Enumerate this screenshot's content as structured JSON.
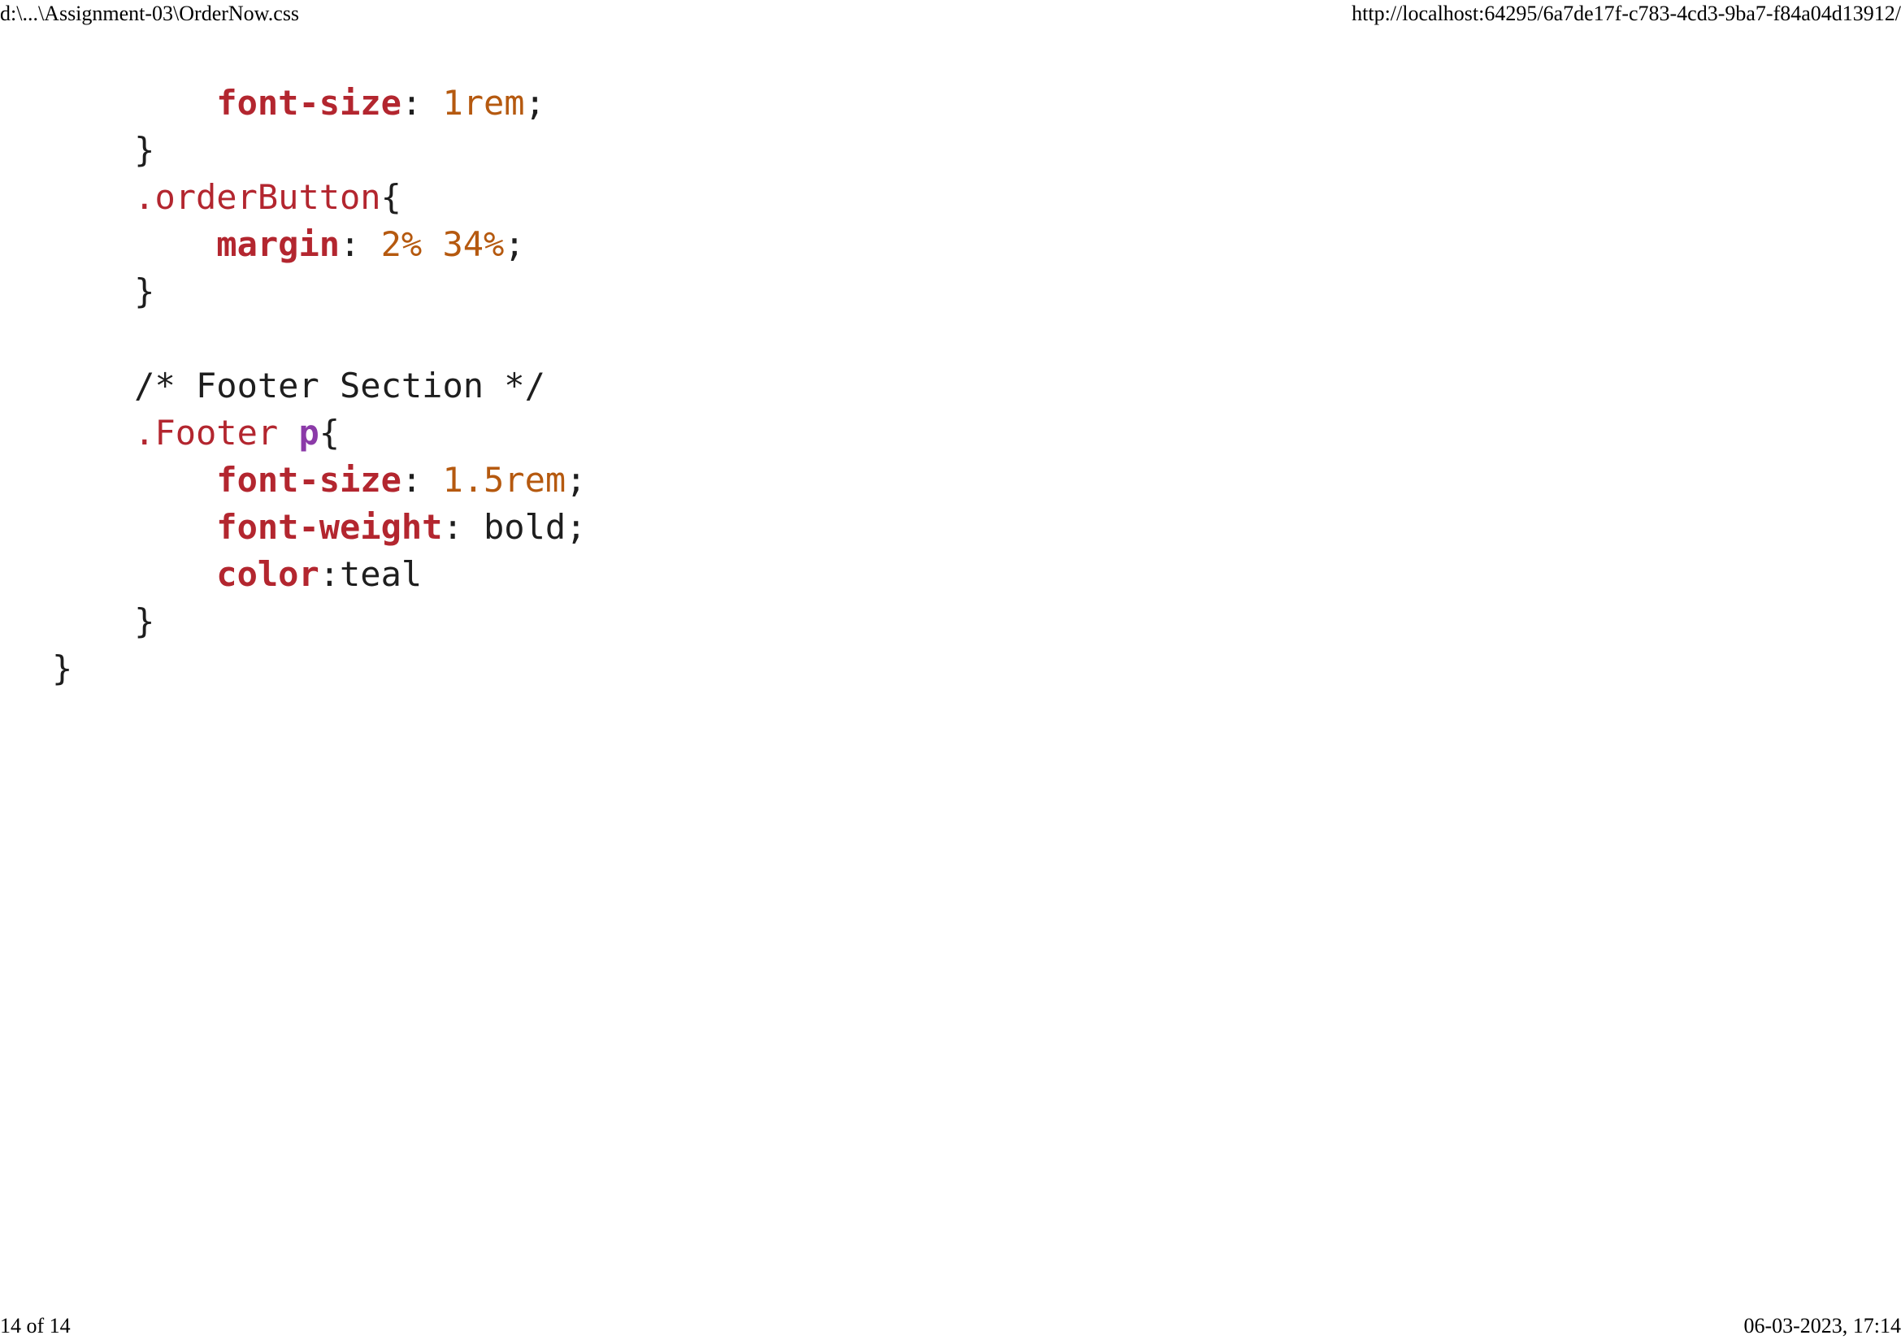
{
  "header": {
    "file_path": "d:\\...\\Assignment-03\\OrderNow.css",
    "url": "http://localhost:64295/6a7de17f-c783-4cd3-9ba7-f84a04d13912/"
  },
  "footer": {
    "page_indicator": "14 of 14",
    "datetime": "06-03-2023, 17:14"
  },
  "code_lines": [
    {
      "indent": "        ",
      "tokens": [
        {
          "t": "prop",
          "v": "font-size"
        },
        {
          "t": "plain",
          "v": ": "
        },
        {
          "t": "num",
          "v": "1rem"
        },
        {
          "t": "plain",
          "v": ";"
        }
      ]
    },
    {
      "indent": "    ",
      "tokens": [
        {
          "t": "plain",
          "v": "}"
        }
      ]
    },
    {
      "indent": "    ",
      "tokens": [
        {
          "t": "sel",
          "v": ".orderButton"
        },
        {
          "t": "plain",
          "v": "{"
        }
      ]
    },
    {
      "indent": "        ",
      "tokens": [
        {
          "t": "prop",
          "v": "margin"
        },
        {
          "t": "plain",
          "v": ": "
        },
        {
          "t": "num",
          "v": "2% 34%"
        },
        {
          "t": "plain",
          "v": ";"
        }
      ]
    },
    {
      "indent": "    ",
      "tokens": [
        {
          "t": "plain",
          "v": "}"
        }
      ]
    },
    {
      "indent": "",
      "tokens": []
    },
    {
      "indent": "    ",
      "tokens": [
        {
          "t": "comment",
          "v": "/* Footer Section */"
        }
      ]
    },
    {
      "indent": "    ",
      "tokens": [
        {
          "t": "sel",
          "v": ".Footer "
        },
        {
          "t": "tag",
          "v": "p"
        },
        {
          "t": "plain",
          "v": "{"
        }
      ]
    },
    {
      "indent": "        ",
      "tokens": [
        {
          "t": "prop",
          "v": "font-size"
        },
        {
          "t": "plain",
          "v": ": "
        },
        {
          "t": "num",
          "v": "1.5rem"
        },
        {
          "t": "plain",
          "v": ";"
        }
      ]
    },
    {
      "indent": "        ",
      "tokens": [
        {
          "t": "prop",
          "v": "font-weight"
        },
        {
          "t": "plain",
          "v": ": bold;"
        }
      ]
    },
    {
      "indent": "        ",
      "tokens": [
        {
          "t": "prop",
          "v": "color"
        },
        {
          "t": "plain",
          "v": ":teal"
        }
      ]
    },
    {
      "indent": "    ",
      "tokens": [
        {
          "t": "plain",
          "v": "}"
        }
      ]
    },
    {
      "indent": "",
      "tokens": [
        {
          "t": "plain",
          "v": "}"
        }
      ]
    }
  ]
}
